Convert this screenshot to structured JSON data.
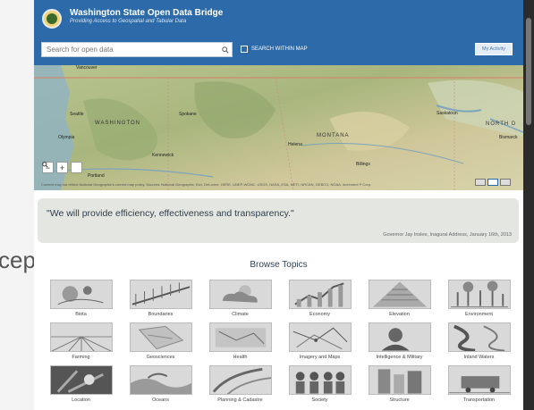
{
  "left_fragment": "cept",
  "header": {
    "title": "Washington State Open Data Bridge",
    "subtitle": "Providing Access to Geospatial and Tabular Data",
    "search_placeholder": "Search for open data",
    "within_map_label": "SEARCH WITHIN MAP",
    "activity_button": "My Activity"
  },
  "map": {
    "labels": [
      "WASHINGTON",
      "MONTANA",
      "NORTH D"
    ],
    "cities": [
      "Vancouver",
      "Seattle",
      "Olympia",
      "Spokane",
      "Kennewick",
      "Portland",
      "Helena",
      "Billings",
      "Saskatoon",
      "Bismarck"
    ],
    "zoom_in": "+",
    "zoom_out": "−",
    "attribution": "Content may not reflect National Geographic's current map policy. Sources: National Geographic, Esri, DeLorme, HERE, UNEP-WCMC, USGS, NASA, ESA, METI, NRCAN, GEBCO, NOAA, increment P Corp."
  },
  "quote": {
    "text": "\"We will provide efficiency, effectiveness and transparency.\"",
    "attribution": "Governor Jay Inslee, Inagural Address, January 16th, 2013"
  },
  "browse": {
    "title": "Browse Topics",
    "topics": [
      {
        "label": "Biota",
        "icon": "biota-icon"
      },
      {
        "label": "Boundaries",
        "icon": "boundaries-icon"
      },
      {
        "label": "Climate",
        "icon": "climate-icon"
      },
      {
        "label": "Economy",
        "icon": "economy-icon"
      },
      {
        "label": "Elevation",
        "icon": "elevation-icon"
      },
      {
        "label": "Environment",
        "icon": "environment-icon"
      },
      {
        "label": "Farming",
        "icon": "farming-icon"
      },
      {
        "label": "Geosciences",
        "icon": "geosciences-icon"
      },
      {
        "label": "Health",
        "icon": "health-icon"
      },
      {
        "label": "Imagery and Maps",
        "icon": "imagery-icon"
      },
      {
        "label": "Intelligence & Military",
        "icon": "military-icon"
      },
      {
        "label": "Inland Waters",
        "icon": "waters-icon"
      },
      {
        "label": "Location",
        "icon": "location-icon"
      },
      {
        "label": "Oceans",
        "icon": "oceans-icon"
      },
      {
        "label": "Planning & Cadastre",
        "icon": "planning-icon"
      },
      {
        "label": "Society",
        "icon": "society-icon"
      },
      {
        "label": "Structure",
        "icon": "structure-icon"
      },
      {
        "label": "Transportation",
        "icon": "transportation-icon"
      }
    ]
  },
  "colors": {
    "header_blue": "#2c6aa9",
    "quote_bg": "#e4e6e1",
    "map_base": "#c8cfa4"
  }
}
